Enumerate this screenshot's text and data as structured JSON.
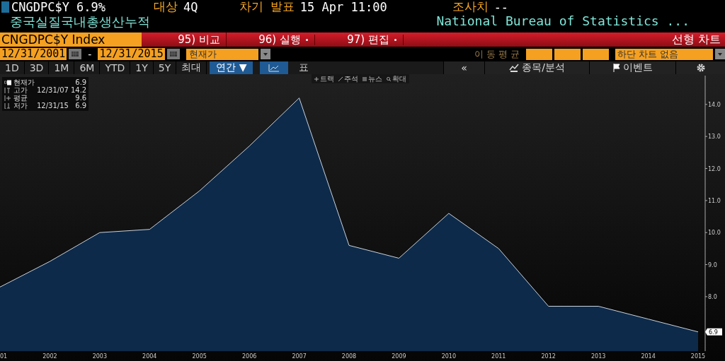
{
  "header": {
    "ticker": "CNGDPC$Y 6.9%",
    "period_label": "대상",
    "period_value": "4Q",
    "next_label": "차기 발표",
    "next_value": "15 Apr 11:00",
    "survey_label": "조사치",
    "survey_value": "--",
    "description": "중국실질국내총생산누적",
    "source": "National Bureau of Statistics ..."
  },
  "command_bar": {
    "security": "CNGDPC$Y Index",
    "menus": [
      {
        "label": "95) 비교",
        "dropdown": false
      },
      {
        "label": "96) 실행",
        "dropdown": true
      },
      {
        "label": "97) 편집",
        "dropdown": true
      }
    ],
    "chart_type": "선형 차트"
  },
  "range_bar": {
    "start_date": "12/31/2001",
    "separator": "-",
    "end_date": "12/31/2015",
    "field": "현재가",
    "moving_average_label": "이 동 평 균",
    "lower_chart": "하단 차트 없음"
  },
  "toolbar": {
    "periods": [
      {
        "label": "1D",
        "selected": false
      },
      {
        "label": "3D",
        "selected": false
      },
      {
        "label": "1M",
        "selected": false
      },
      {
        "label": "6M",
        "selected": false
      },
      {
        "label": "YTD",
        "selected": false
      },
      {
        "label": "1Y",
        "selected": false
      },
      {
        "label": "5Y",
        "selected": false
      },
      {
        "label": "최대",
        "selected": false
      }
    ],
    "frequency": "연간 ▼",
    "views": [
      {
        "kind": "chart",
        "selected": true
      },
      {
        "kind": "table",
        "label": "표",
        "selected": false
      }
    ],
    "collapse": "«",
    "analysis": "종목/분석",
    "events": "이벤트"
  },
  "chart_tools": [
    {
      "kind": "track",
      "label": "트랙"
    },
    {
      "kind": "annotate",
      "label": "주석"
    },
    {
      "kind": "news",
      "label": "뉴스"
    },
    {
      "kind": "zoom",
      "label": "확대"
    }
  ],
  "legend": [
    {
      "kind": "last",
      "value": "6.9"
    },
    {
      "kind": "high",
      "label": "고가",
      "date": "12/31/07",
      "value": "14.2"
    },
    {
      "kind": "average",
      "label": "평균",
      "value": "9.6"
    },
    {
      "kind": "low",
      "label": "저가",
      "date": "12/31/15",
      "value": "6.9"
    }
  ],
  "last_value_tag": "6.9",
  "chart_data": {
    "type": "area",
    "x": [
      2001,
      2002,
      2003,
      2004,
      2005,
      2006,
      2007,
      2008,
      2009,
      2010,
      2011,
      2012,
      2013,
      2014,
      2015
    ],
    "series": [
      {
        "name": "현재가",
        "color": "#0e2a4a",
        "values": [
          8.3,
          9.1,
          10.0,
          10.1,
          11.3,
          12.7,
          14.2,
          9.6,
          9.2,
          10.6,
          9.5,
          7.7,
          7.7,
          7.3,
          6.9
        ]
      }
    ],
    "xlim": [
      2001,
      2015
    ],
    "xticks": [
      {
        "value": 2001,
        "label": "01"
      },
      2002,
      2003,
      2004,
      2005,
      2006,
      2007,
      2008,
      2009,
      2010,
      2011,
      2012,
      2013,
      2014,
      2015
    ],
    "yticks": [
      {
        "value": 8,
        "label": "8.0"
      },
      {
        "value": 9,
        "label": "9.0"
      },
      {
        "value": 10,
        "label": "10.0"
      },
      {
        "value": 11,
        "label": "11.0"
      },
      {
        "value": 12,
        "label": "12.0"
      },
      {
        "value": 13,
        "label": "13.0"
      },
      {
        "value": 14,
        "label": "14.0"
      }
    ],
    "ylim": [
      6.3,
      14.9
    ]
  }
}
